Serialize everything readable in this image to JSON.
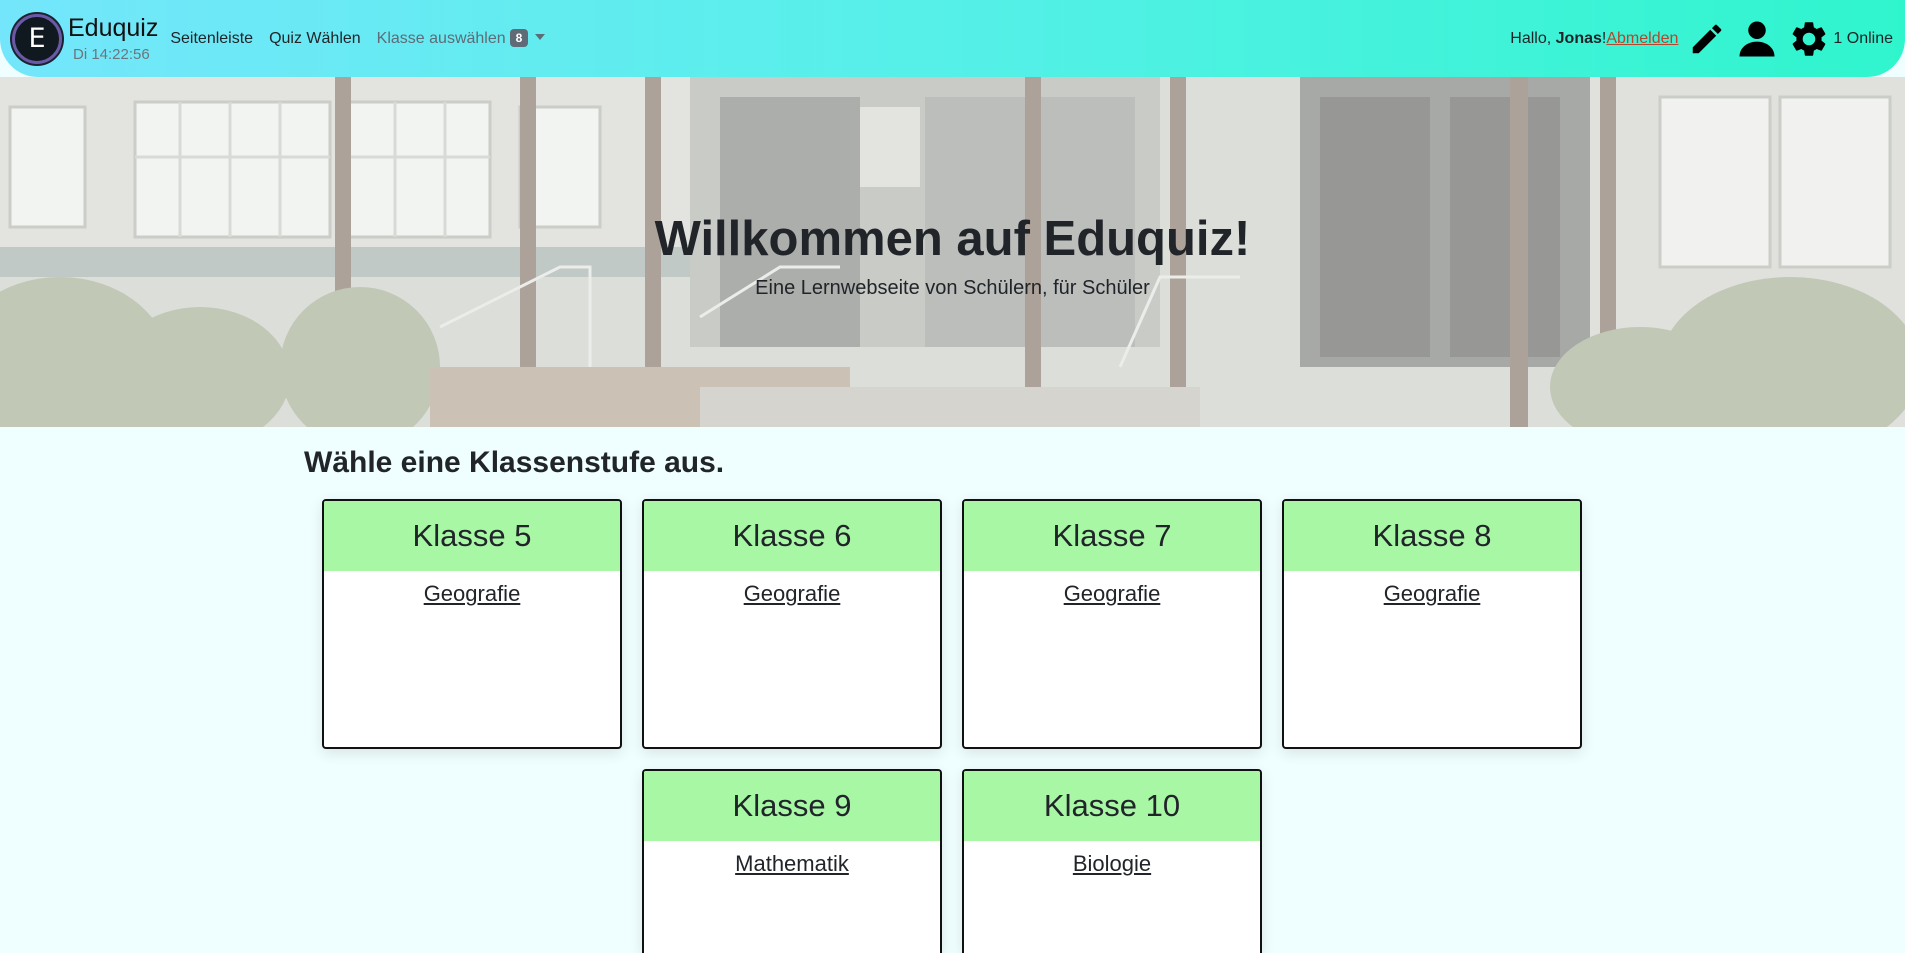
{
  "brand": {
    "logo_letter": "E",
    "name": "Eduquiz",
    "clock": "Di 14:22:56"
  },
  "nav": {
    "sidebar": "Seitenleiste",
    "choose_quiz": "Quiz Wählen",
    "choose_class": "Klasse auswählen",
    "class_badge": "8"
  },
  "user": {
    "greeting": "Hallo, ",
    "name": "Jonas",
    "punct": "! ",
    "logout": "Abmelden",
    "online": "1 Online"
  },
  "icons": {
    "edit": "pencil-icon",
    "profile": "user-icon",
    "settings": "gear-icon"
  },
  "hero": {
    "title": "Willkommen auf Eduquiz!",
    "subtitle": "Eine Lernwebseite von Schülern, für Schüler"
  },
  "main": {
    "heading": "Wähle eine Klassenstufe aus.",
    "cards": [
      {
        "title": "Klasse 5",
        "subject": "Geografie"
      },
      {
        "title": "Klasse 6",
        "subject": "Geografie"
      },
      {
        "title": "Klasse 7",
        "subject": "Geografie"
      },
      {
        "title": "Klasse 8",
        "subject": "Geografie"
      },
      {
        "title": "Klasse 9",
        "subject": "Mathematik"
      },
      {
        "title": "Klasse 10",
        "subject": "Biologie"
      }
    ]
  },
  "colors": {
    "nav_gradient_start": "#74e6fb",
    "nav_gradient_end": "#2ff5cd",
    "card_header": "#a7f7a5",
    "page_bg": "#effefe",
    "logout": "#b5462d"
  }
}
